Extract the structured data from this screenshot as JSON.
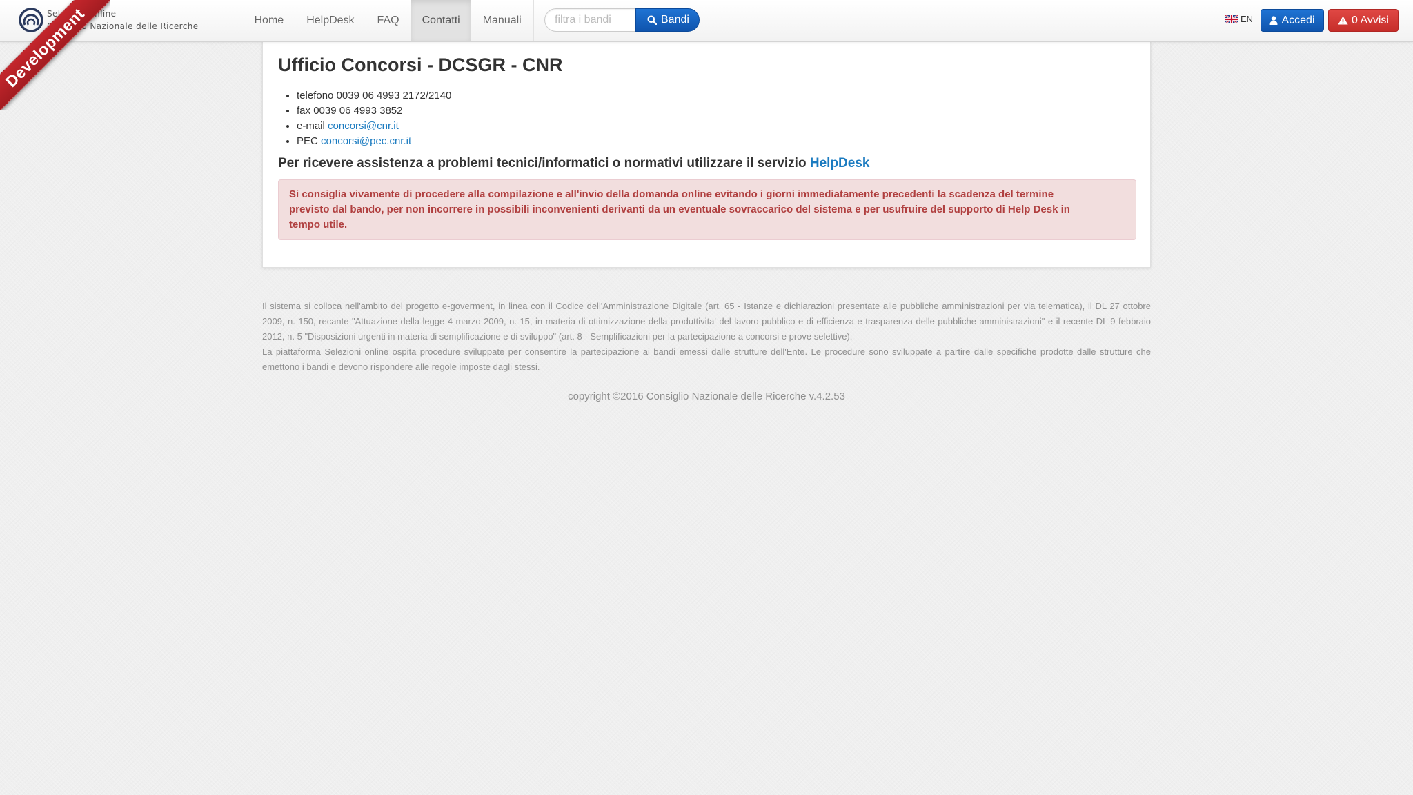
{
  "ribbon": {
    "label": "Development"
  },
  "brand": {
    "line1": "Selezioni online",
    "line2": "Consiglio Nazionale delle Ricerche"
  },
  "nav": {
    "items": [
      {
        "label": "Home"
      },
      {
        "label": "HelpDesk"
      },
      {
        "label": "FAQ"
      },
      {
        "label": "Contatti",
        "active": true
      },
      {
        "label": "Manuali"
      }
    ]
  },
  "search": {
    "placeholder": "filtra i bandi",
    "value": "",
    "button_label": "Bandi",
    "icon": "search-icon"
  },
  "lang": {
    "label": "EN",
    "flag": "uk-flag-icon"
  },
  "user": {
    "login_label": "Accedi",
    "login_icon": "user-icon"
  },
  "alerts": {
    "label": "0 Avvisi",
    "icon": "warning-icon"
  },
  "contacts": {
    "title": "Ufficio Concorsi - DCSGR - CNR",
    "items": [
      {
        "prefix": "telefono",
        "value": "0039 06 4993 2172/2140"
      },
      {
        "prefix": "fax",
        "value": "0039 06 4993 3852"
      },
      {
        "prefix": "e-mail",
        "link": "concorsi@cnr.it"
      },
      {
        "prefix": "PEC",
        "link": "concorsi@pec.cnr.it"
      }
    ],
    "assistance_text": "Per ricevere assistenza a problemi tecnici/informatici o normativi utilizzare il servizio",
    "assistance_link": "HelpDesk",
    "warning": "Si consiglia vivamente di procedere alla compilazione e all'invio della domanda online evitando i giorni immediatamente precedenti la scadenza del termine previsto dal bando, per non incorrere in possibili inconvenienti derivanti da un eventuale sovraccarico del sistema e per usufruire del supporto di Help Desk in tempo utile."
  },
  "footer": {
    "paragraph1": "Il sistema si colloca nell'ambito del progetto e-goverment, in linea con il Codice dell'Amministrazione Digitale (art. 65 - Istanze e dichiarazioni presentate alle pubbliche amministrazioni per via telematica), il DL 27 ottobre 2009, n. 150, recante \"Attuazione della legge 4 marzo 2009, n. 15, in materia di ottimizzazione della produttivita' del lavoro pubblico e di efficienza e trasparenza delle pubbliche amministrazioni\" e il recente DL 9 febbraio 2012, n. 5 \"Disposizioni urgenti in materia di semplificazione e di sviluppo\" (art. 8 - Semplificazioni per la partecipazione a concorsi e prove selettive).",
    "paragraph2": "La piattaforma Selezioni online ospita procedure sviluppate per consentire la partecipazione ai bandi emessi dalle strutture dell'Ente. Le procedure sono sviluppate a partire dalle specifiche prodotte dalle strutture che emettono i bandi e devono rispondere alle regole imposte dagli stessi.",
    "copyright": "copyright ©2016 Consiglio Nazionale delle Ricerche v.4.2.53"
  },
  "colors": {
    "primary": "#1565c0",
    "danger": "#d9534f",
    "link": "#1b7bc0",
    "alert_bg": "#f2dede",
    "alert_text": "#b03f3f",
    "ribbon": "#b71c1c"
  }
}
